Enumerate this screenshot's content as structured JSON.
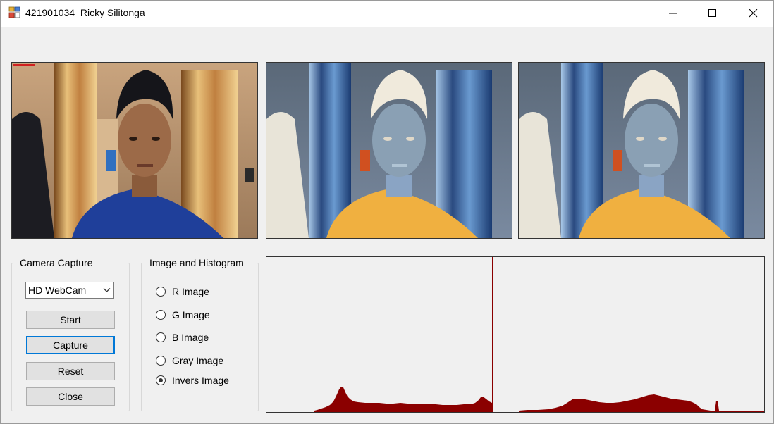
{
  "window": {
    "title": "421901034_Ricky Silitonga",
    "controls": [
      "minimize",
      "maximize",
      "close"
    ]
  },
  "images": [
    {
      "name": "original-camera-image"
    },
    {
      "name": "inverted-image-1"
    },
    {
      "name": "inverted-image-2"
    }
  ],
  "camera_capture": {
    "group_title": "Camera Capture",
    "device_select": {
      "value": "HD WebCam"
    },
    "buttons": {
      "start": "Start",
      "capture": "Capture",
      "reset": "Reset",
      "close": "Close"
    },
    "focused_button": "capture"
  },
  "image_histogram": {
    "group_title": "Image and Histogram",
    "options": [
      {
        "label": "R Image",
        "checked": false
      },
      {
        "label": "G Image",
        "checked": false
      },
      {
        "label": "B Image",
        "checked": false
      },
      {
        "label": "Gray Image",
        "checked": false
      },
      {
        "label": "Invers Image",
        "checked": true
      }
    ]
  },
  "histogram": {
    "color": "#8b0000"
  },
  "colors": {
    "window_bg": "#f0f0f0",
    "focus_border": "#0078d7",
    "histogram_fill": "#8b0000"
  }
}
